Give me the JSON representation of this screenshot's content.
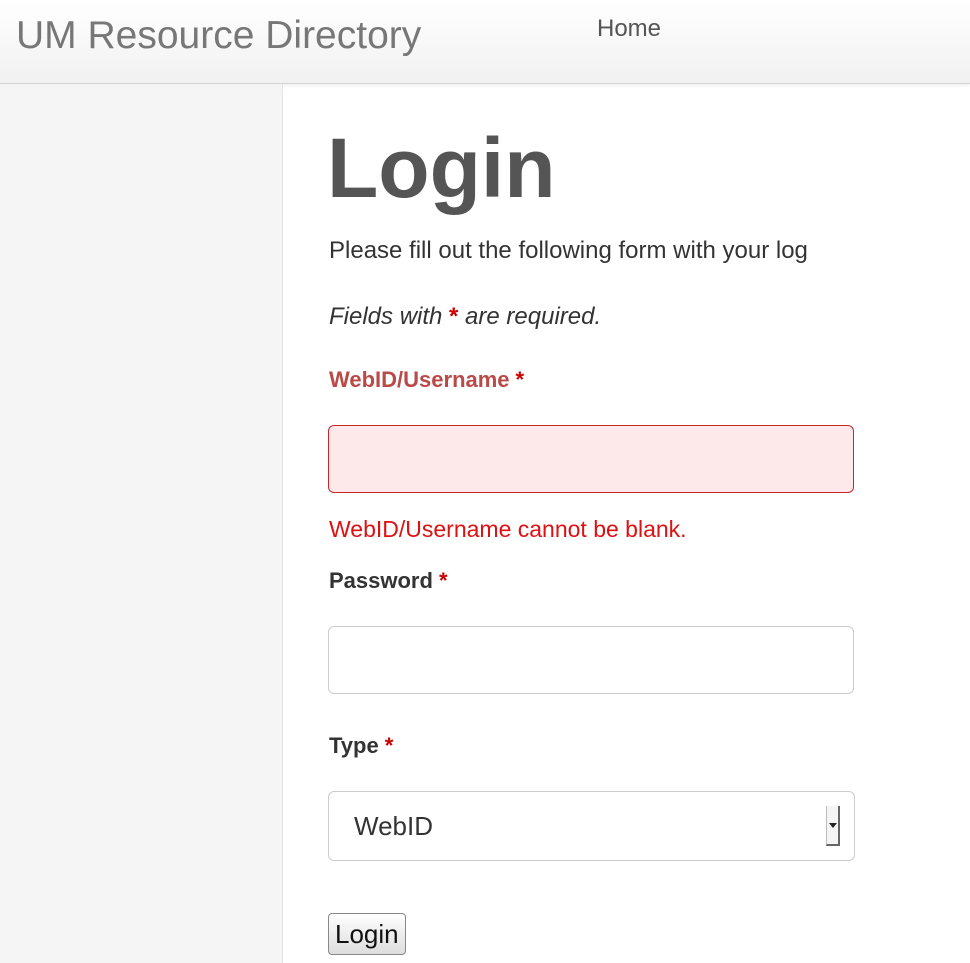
{
  "navbar": {
    "brand": "UM Resource Directory",
    "links": [
      {
        "label": "Home"
      }
    ]
  },
  "page": {
    "title": "Login",
    "intro": "Please fill out the following form with your log",
    "required_note_prefix": "Fields with ",
    "required_marker": "*",
    "required_note_suffix": " are required."
  },
  "form": {
    "username": {
      "label": "WebID/Username",
      "value": "",
      "error": "WebID/Username cannot be blank."
    },
    "password": {
      "label": "Password",
      "value": ""
    },
    "type": {
      "label": "Type",
      "selected": "WebID"
    },
    "submit_label": "Login"
  },
  "colors": {
    "error_text": "#dd1111",
    "error_label": "#b94a48",
    "error_field_bg": "#fde9e9",
    "error_border": "#c8262d"
  }
}
